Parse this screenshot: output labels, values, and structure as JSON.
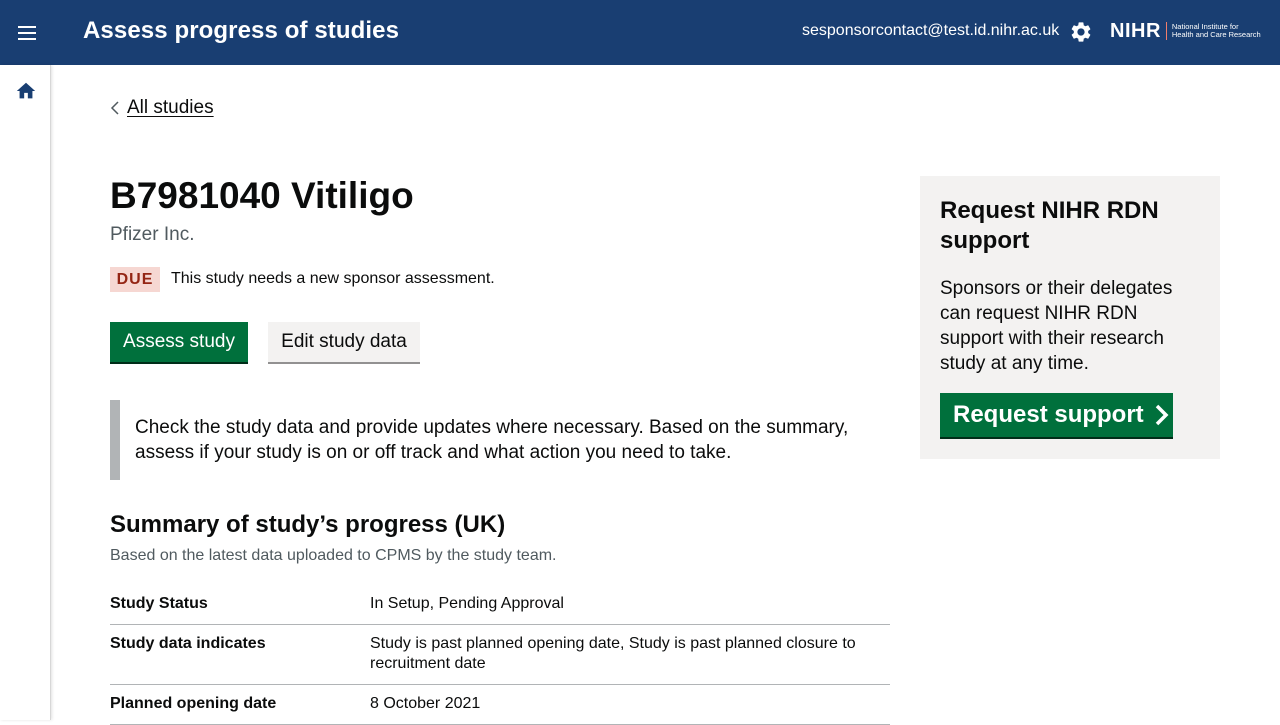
{
  "header": {
    "title": "Assess progress of studies",
    "user_email": "sesponsorcontact@test.id.nihr.ac.uk",
    "logo_text": "NIHR",
    "logo_subtitle_line1": "National Institute for",
    "logo_subtitle_line2": "Health and Care Research",
    "menu_icon": "hamburger-menu-icon",
    "settings_icon": "gear-icon"
  },
  "sidenav": {
    "home_icon": "home-icon"
  },
  "back_link": {
    "label": "All studies"
  },
  "study": {
    "title": "B7981040 Vitiligo",
    "sponsor": "Pfizer Inc.",
    "status_tag": "DUE",
    "status_text": "This study needs a new sponsor assessment."
  },
  "actions": {
    "assess_label": "Assess study",
    "edit_label": "Edit study data"
  },
  "inset_text": "Check the study data and provide updates where necessary. Based on the summary, assess if your study is on or off track and what action you need to take.",
  "summary": {
    "heading": "Summary of study’s progress (UK)",
    "subheading": "Based on the latest data uploaded to CPMS by the study team.",
    "rows": [
      {
        "key": "Study Status",
        "value": "In Setup, Pending Approval"
      },
      {
        "key": "Study data indicates",
        "value": "Study is past planned opening date, Study is past planned closure to recruitment date"
      },
      {
        "key": "Planned opening date",
        "value": "8 October 2021"
      }
    ]
  },
  "support_panel": {
    "heading": "Request NIHR RDN support",
    "body": "Sponsors or their delegates can request NIHR RDN support with their research study at any time.",
    "button_label": "Request support"
  },
  "colors": {
    "header_bg": "#193e72",
    "primary_button": "#00703c",
    "due_tag_bg": "#f6d7d2",
    "due_tag_text": "#942514",
    "panel_bg": "#f3f2f1"
  }
}
